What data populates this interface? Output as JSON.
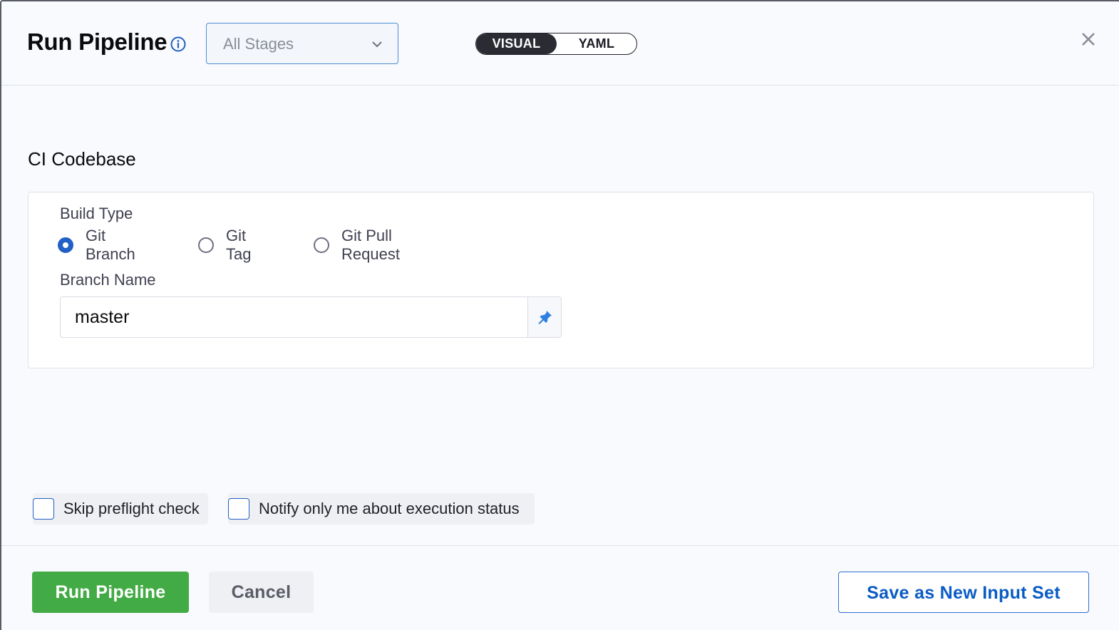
{
  "header": {
    "title": "Run Pipeline",
    "stage_select_value": "All Stages",
    "view_toggle": {
      "visual_label": "VISUAL",
      "yaml_label": "YAML",
      "selected": "VISUAL"
    }
  },
  "codebase": {
    "section_title": "CI Codebase",
    "build_type_label": "Build Type",
    "build_types": [
      {
        "label": "Git Branch",
        "checked": true
      },
      {
        "label": "Git Tag",
        "checked": false
      },
      {
        "label": "Git Pull Request",
        "checked": false
      }
    ],
    "branch_name_label": "Branch Name",
    "branch_name_value": "master"
  },
  "options": {
    "skip_preflight_label": "Skip preflight check",
    "notify_label": "Notify only me about execution status"
  },
  "footer": {
    "run_label": "Run Pipeline",
    "cancel_label": "Cancel",
    "save_input_set_label": "Save as New Input Set"
  },
  "colors": {
    "accent": "#2160c4",
    "run_button": "#42ab45",
    "toggle_active": "#2a2b33"
  },
  "icons": [
    "info-icon",
    "chevron-down-icon",
    "close-icon",
    "pin-icon"
  ]
}
